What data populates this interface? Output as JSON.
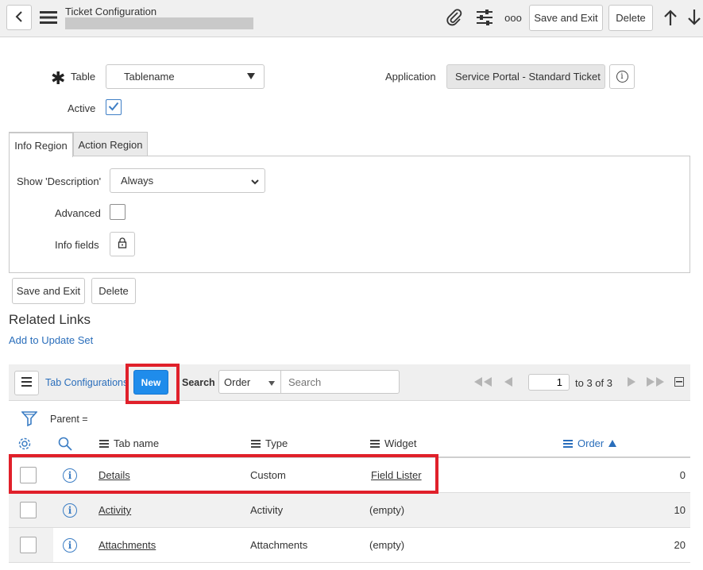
{
  "header": {
    "title": "Ticket Configuration",
    "save_exit_label": "Save and Exit",
    "delete_label": "Delete",
    "more_label": "ooo"
  },
  "form": {
    "table_label": "Table",
    "table_value": "Tablename",
    "application_label": "Application",
    "application_value": "Service Portal - Standard Ticket",
    "active_label": "Active",
    "active_checked": true
  },
  "tabs": [
    {
      "label": "Info Region",
      "active": true
    },
    {
      "label": "Action Region",
      "active": false
    }
  ],
  "info_region": {
    "show_description_label": "Show 'Description'",
    "show_description_value": "Always",
    "advanced_label": "Advanced",
    "info_fields_label": "Info fields"
  },
  "bottom_buttons": {
    "save_exit_label": "Save and Exit",
    "delete_label": "Delete"
  },
  "related_links": {
    "title": "Related Links",
    "add_to_update_set": "Add to Update Set"
  },
  "list": {
    "title": "Tab Configurations",
    "new_label": "New",
    "search_label": "Search",
    "search_field": "Order",
    "search_placeholder": "Search",
    "page_value": "1",
    "page_total": "to 3 of 3",
    "filter_text": "Parent =",
    "columns": {
      "tab_name": "Tab name",
      "type": "Type",
      "widget": "Widget",
      "order": "Order"
    },
    "rows": [
      {
        "tab_name": "Details",
        "type": "Custom",
        "widget": "Field Lister",
        "order": "0"
      },
      {
        "tab_name": "Activity",
        "type": "Activity",
        "widget": "(empty)",
        "order": "10"
      },
      {
        "tab_name": "Attachments",
        "type": "Attachments",
        "widget": "(empty)",
        "order": "20"
      }
    ]
  },
  "colors": {
    "accent_blue": "#2a6ebb",
    "new_button": "#1f8ceb",
    "highlight_red": "#e0202a"
  }
}
